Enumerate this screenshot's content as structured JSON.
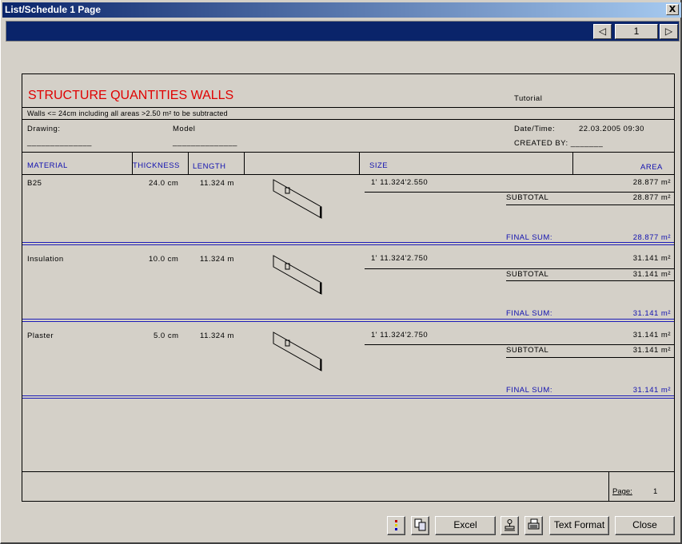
{
  "window": {
    "title": "List/Schedule 1 Page",
    "close_glyph": "X"
  },
  "nav": {
    "prev_glyph": "◁",
    "page_value": "1",
    "next_glyph": "▷"
  },
  "report": {
    "title": "STRUCTURE QUANTITIES WALLS",
    "project": "Tutorial",
    "subtitle": "Walls <= 24cm including all areas  >2.50 m² to be subtracted",
    "drawing_label": "Drawing:",
    "drawing_blank": "______________",
    "model_label": "Model",
    "model_blank": "______________",
    "datetime_label": "Date/Time:",
    "datetime_value": "22.03.2005  09:30",
    "created_by_label": "CREATED BY: _______",
    "columns": {
      "material": "MATERIAL",
      "thickness": "THICKNESS",
      "length": "LENGTH",
      "size": "SIZE",
      "area": "AREA"
    },
    "rows": [
      {
        "material": "B25",
        "thickness": "24.0 cm",
        "length": "11.324 m",
        "size": "1' 11.324'2.550",
        "area": "28.877 m²",
        "subtotal_label": "SUBTOTAL",
        "subtotal": "28.877 m²",
        "final_label": "FINAL SUM:",
        "final": "28.877 m²"
      },
      {
        "material": "Insulation",
        "thickness": "10.0 cm",
        "length": "11.324 m",
        "size": "1' 11.324'2.750",
        "area": "31.141 m²",
        "subtotal_label": "SUBTOTAL",
        "subtotal": "31.141 m²",
        "final_label": "FINAL SUM:",
        "final": "31.141 m²"
      },
      {
        "material": "Plaster",
        "thickness": "5.0 cm",
        "length": "11.324 m",
        "size": "1' 11.324'2.750",
        "area": "31.141 m²",
        "subtotal_label": "SUBTOTAL",
        "subtotal": "31.141 m²",
        "final_label": "FINAL SUM:",
        "final": "31.141 m²"
      }
    ],
    "footer": {
      "page_label": "Page:",
      "page_value": "1"
    }
  },
  "buttons": {
    "excel": "Excel",
    "text_format": "Text Format",
    "close": "Close"
  },
  "colors": {
    "title_red": "#e00000",
    "label_blue": "#1010b0",
    "nav_bg": "#0a246a"
  }
}
